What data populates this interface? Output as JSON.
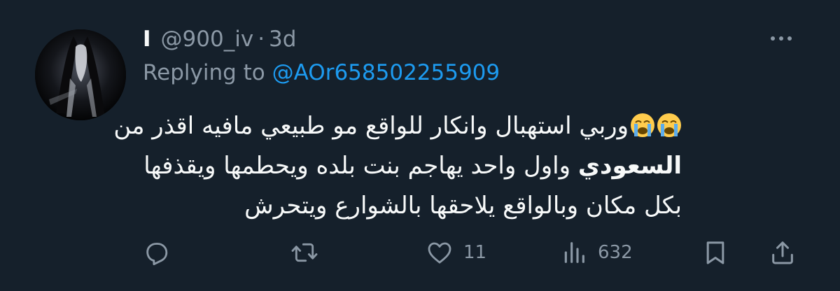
{
  "tweet": {
    "display_name": "I",
    "handle": "@900_iv",
    "separator": "·",
    "time": "3d",
    "more_label": "···",
    "replying_to_label": "Replying to",
    "replying_to_handle": "@AOr658502255909",
    "body": {
      "line1_emojis": [
        "loudly-crying-face",
        "loudly-crying-face"
      ],
      "line1_text": "وربي استهبال وانكار للواقع مو طبيعي مافيه اقذر من",
      "line2_bold": "السعودي",
      "line2_text": " واول واحد يهاجم بنت بلده ويحطمها ويقذفها",
      "line3_text": "بكل مكان وبالواقع يلاحقها بالشوارع ويتحرش"
    }
  },
  "actions": {
    "reply": {
      "icon": "reply-icon",
      "count": ""
    },
    "retweet": {
      "icon": "retweet-icon",
      "count": ""
    },
    "like": {
      "icon": "heart-icon",
      "count": "11"
    },
    "views": {
      "icon": "views-icon",
      "count": "632"
    },
    "bookmark": {
      "icon": "bookmark-icon",
      "count": ""
    },
    "share": {
      "icon": "share-icon",
      "count": ""
    }
  },
  "colors": {
    "background": "#15202b",
    "primary_text": "#f7f9f9",
    "secondary_text": "#8b98a5",
    "link": "#1d9bf0"
  }
}
